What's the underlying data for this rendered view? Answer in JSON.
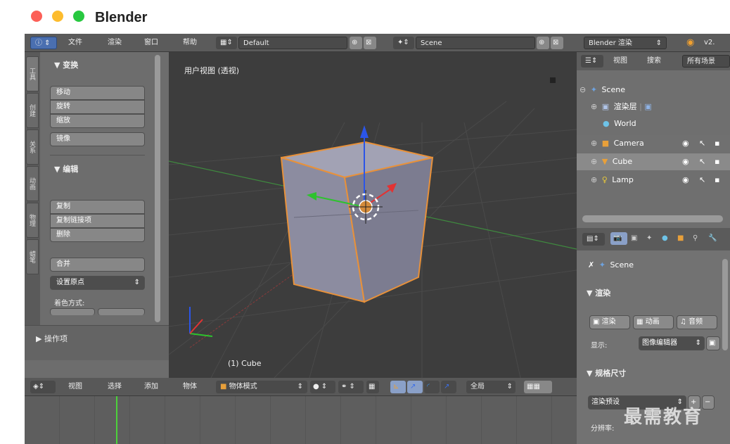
{
  "app": {
    "title": "Blender"
  },
  "header": {
    "menus": [
      "文件",
      "渲染",
      "窗口",
      "帮助"
    ],
    "layout": "Default",
    "scene": "Scene",
    "engine": "Blender 渲染",
    "version": "v2."
  },
  "tools": {
    "tabs": [
      "工具",
      "创建",
      "关系",
      "动画",
      "物理",
      "蜡笔"
    ],
    "transform_header": "▼ 变换",
    "transform_buttons": [
      "移动",
      "旋转",
      "缩放",
      "镜像"
    ],
    "edit_header": "▼ 编辑",
    "edit_buttons": [
      "复制",
      "复制链接项",
      "删除",
      "合并"
    ],
    "set_origin": "设置原点",
    "shading_label": "着色方式:",
    "operator_header": "▶ 操作项"
  },
  "viewport": {
    "view_label": "用户视图 (透视)",
    "object_label": "(1) Cube"
  },
  "outliner": {
    "menus": [
      "视图",
      "搜索"
    ],
    "filter": "所有场景",
    "items": [
      {
        "name": "Scene",
        "icon": "scene-icon"
      },
      {
        "name": "渲染层",
        "icon": "render-layer-icon"
      },
      {
        "name": "World",
        "icon": "world-icon"
      },
      {
        "name": "Camera",
        "icon": "camera-icon"
      },
      {
        "name": "Cube",
        "icon": "mesh-icon"
      },
      {
        "name": "Lamp",
        "icon": "lamp-icon"
      }
    ]
  },
  "properties": {
    "breadcrumb": "Scene",
    "render_header": "▼ 渲染",
    "render_btn": "渲染",
    "anim_btn": "动画",
    "audio_btn": "音频",
    "display_label": "显示:",
    "display_value": "图像编辑器",
    "dimensions_header": "▼ 规格尺寸",
    "preset": "渲染预设",
    "resolution_label": "分辨率:"
  },
  "timeline": {
    "menus": [
      "视图",
      "选择",
      "添加",
      "物体"
    ],
    "mode": "物体模式",
    "global": "全局"
  },
  "watermark": "最需教育"
}
